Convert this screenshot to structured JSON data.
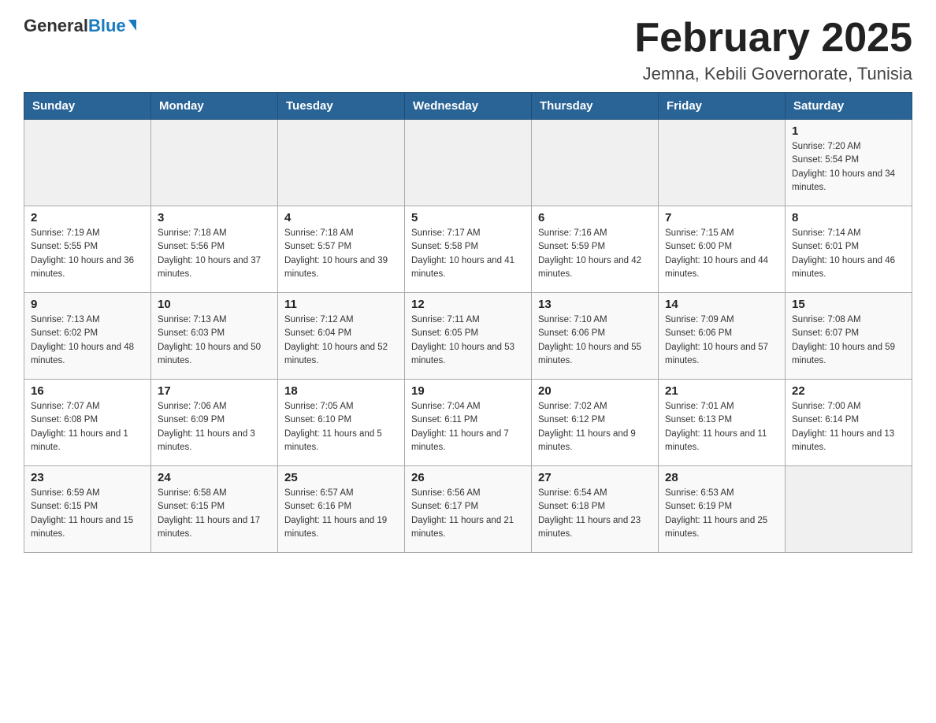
{
  "logo": {
    "general": "General",
    "blue": "Blue"
  },
  "header": {
    "month": "February 2025",
    "location": "Jemna, Kebili Governorate, Tunisia"
  },
  "weekdays": [
    "Sunday",
    "Monday",
    "Tuesday",
    "Wednesday",
    "Thursday",
    "Friday",
    "Saturday"
  ],
  "weeks": [
    [
      {
        "day": "",
        "info": ""
      },
      {
        "day": "",
        "info": ""
      },
      {
        "day": "",
        "info": ""
      },
      {
        "day": "",
        "info": ""
      },
      {
        "day": "",
        "info": ""
      },
      {
        "day": "",
        "info": ""
      },
      {
        "day": "1",
        "info": "Sunrise: 7:20 AM\nSunset: 5:54 PM\nDaylight: 10 hours and 34 minutes."
      }
    ],
    [
      {
        "day": "2",
        "info": "Sunrise: 7:19 AM\nSunset: 5:55 PM\nDaylight: 10 hours and 36 minutes."
      },
      {
        "day": "3",
        "info": "Sunrise: 7:18 AM\nSunset: 5:56 PM\nDaylight: 10 hours and 37 minutes."
      },
      {
        "day": "4",
        "info": "Sunrise: 7:18 AM\nSunset: 5:57 PM\nDaylight: 10 hours and 39 minutes."
      },
      {
        "day": "5",
        "info": "Sunrise: 7:17 AM\nSunset: 5:58 PM\nDaylight: 10 hours and 41 minutes."
      },
      {
        "day": "6",
        "info": "Sunrise: 7:16 AM\nSunset: 5:59 PM\nDaylight: 10 hours and 42 minutes."
      },
      {
        "day": "7",
        "info": "Sunrise: 7:15 AM\nSunset: 6:00 PM\nDaylight: 10 hours and 44 minutes."
      },
      {
        "day": "8",
        "info": "Sunrise: 7:14 AM\nSunset: 6:01 PM\nDaylight: 10 hours and 46 minutes."
      }
    ],
    [
      {
        "day": "9",
        "info": "Sunrise: 7:13 AM\nSunset: 6:02 PM\nDaylight: 10 hours and 48 minutes."
      },
      {
        "day": "10",
        "info": "Sunrise: 7:13 AM\nSunset: 6:03 PM\nDaylight: 10 hours and 50 minutes."
      },
      {
        "day": "11",
        "info": "Sunrise: 7:12 AM\nSunset: 6:04 PM\nDaylight: 10 hours and 52 minutes."
      },
      {
        "day": "12",
        "info": "Sunrise: 7:11 AM\nSunset: 6:05 PM\nDaylight: 10 hours and 53 minutes."
      },
      {
        "day": "13",
        "info": "Sunrise: 7:10 AM\nSunset: 6:06 PM\nDaylight: 10 hours and 55 minutes."
      },
      {
        "day": "14",
        "info": "Sunrise: 7:09 AM\nSunset: 6:06 PM\nDaylight: 10 hours and 57 minutes."
      },
      {
        "day": "15",
        "info": "Sunrise: 7:08 AM\nSunset: 6:07 PM\nDaylight: 10 hours and 59 minutes."
      }
    ],
    [
      {
        "day": "16",
        "info": "Sunrise: 7:07 AM\nSunset: 6:08 PM\nDaylight: 11 hours and 1 minute."
      },
      {
        "day": "17",
        "info": "Sunrise: 7:06 AM\nSunset: 6:09 PM\nDaylight: 11 hours and 3 minutes."
      },
      {
        "day": "18",
        "info": "Sunrise: 7:05 AM\nSunset: 6:10 PM\nDaylight: 11 hours and 5 minutes."
      },
      {
        "day": "19",
        "info": "Sunrise: 7:04 AM\nSunset: 6:11 PM\nDaylight: 11 hours and 7 minutes."
      },
      {
        "day": "20",
        "info": "Sunrise: 7:02 AM\nSunset: 6:12 PM\nDaylight: 11 hours and 9 minutes."
      },
      {
        "day": "21",
        "info": "Sunrise: 7:01 AM\nSunset: 6:13 PM\nDaylight: 11 hours and 11 minutes."
      },
      {
        "day": "22",
        "info": "Sunrise: 7:00 AM\nSunset: 6:14 PM\nDaylight: 11 hours and 13 minutes."
      }
    ],
    [
      {
        "day": "23",
        "info": "Sunrise: 6:59 AM\nSunset: 6:15 PM\nDaylight: 11 hours and 15 minutes."
      },
      {
        "day": "24",
        "info": "Sunrise: 6:58 AM\nSunset: 6:15 PM\nDaylight: 11 hours and 17 minutes."
      },
      {
        "day": "25",
        "info": "Sunrise: 6:57 AM\nSunset: 6:16 PM\nDaylight: 11 hours and 19 minutes."
      },
      {
        "day": "26",
        "info": "Sunrise: 6:56 AM\nSunset: 6:17 PM\nDaylight: 11 hours and 21 minutes."
      },
      {
        "day": "27",
        "info": "Sunrise: 6:54 AM\nSunset: 6:18 PM\nDaylight: 11 hours and 23 minutes."
      },
      {
        "day": "28",
        "info": "Sunrise: 6:53 AM\nSunset: 6:19 PM\nDaylight: 11 hours and 25 minutes."
      },
      {
        "day": "",
        "info": ""
      }
    ]
  ]
}
